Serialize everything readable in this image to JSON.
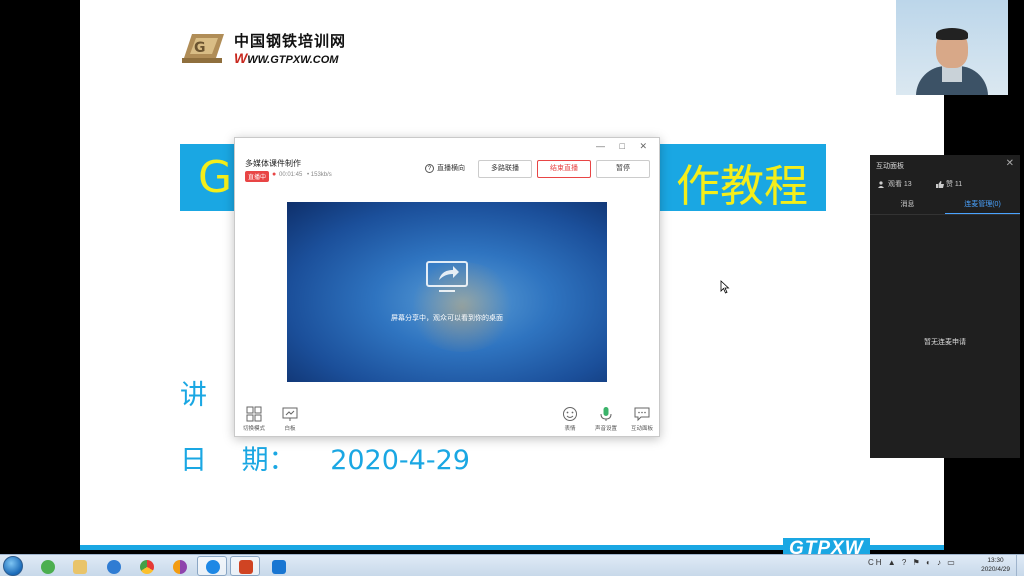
{
  "slide": {
    "logo_cn": "中国钢铁培训网",
    "logo_url_w": "W",
    "logo_url_rest": "WW.GTPXW.COM",
    "title_left": "G",
    "title_right": "作教程",
    "lecturer_label": "讲",
    "date_label": "日 期：",
    "date_value": "2020-4-29",
    "brand": "GTPXW"
  },
  "live_window": {
    "controls": "— □ ✕",
    "course_title": "多媒体课件制作",
    "live_badge": "直播中",
    "live_dot": "●",
    "elapsed": "00:01:45",
    "bitrate": "• 153kb/s",
    "direction_icon": "?",
    "direction_label": "直播横向",
    "multi_stream_button": "多路联播",
    "end_live_button": "结束直播",
    "pause_button": "暂停",
    "share_text": "屏幕分享中，观众可以看到你的桌面",
    "bottom_tools": [
      {
        "label": "切换模式",
        "icon": "grid-icon"
      },
      {
        "label": "白板",
        "icon": "whiteboard-icon"
      },
      {
        "label": "表情",
        "icon": "smiley-icon"
      },
      {
        "label": "声音设置",
        "icon": "microphone-icon"
      },
      {
        "label": "互动面板",
        "icon": "chat-icon"
      }
    ]
  },
  "side_panel": {
    "title": "互动面板",
    "close": "✕",
    "viewers": "观看 13",
    "likes": "赞 11",
    "tab_messages": "消息",
    "tab_mic": "连麦管理(0)",
    "empty_text": "暂无连麦申请"
  },
  "taskbar": {
    "tray": "CH ▲ ? ⚑ ◐ ♪ ▭",
    "time": "13:30",
    "date": "2020/4/29",
    "apps": [
      {
        "name": "thunderbird-icon",
        "color": "#4caf50"
      },
      {
        "name": "file-explorer-icon",
        "color": "#e9c46a"
      },
      {
        "name": "internet-explorer-icon",
        "color": "#2f7cd3"
      },
      {
        "name": "chrome-icon",
        "color": "#e53935"
      },
      {
        "name": "firefox-icon",
        "color": "#8e44ad"
      },
      {
        "name": "live-app-icon",
        "color": "#1e88e5"
      },
      {
        "name": "powerpoint-icon",
        "color": "#d04423"
      },
      {
        "name": "media-app-icon",
        "color": "#1976d2"
      }
    ]
  },
  "colors": {
    "slide_blue": "#1aa7e3",
    "title_yellow": "#f4ee1a",
    "end_red": "#e84545",
    "panel_bg": "#1f1f1f",
    "tab_active": "#4aa3ff"
  }
}
